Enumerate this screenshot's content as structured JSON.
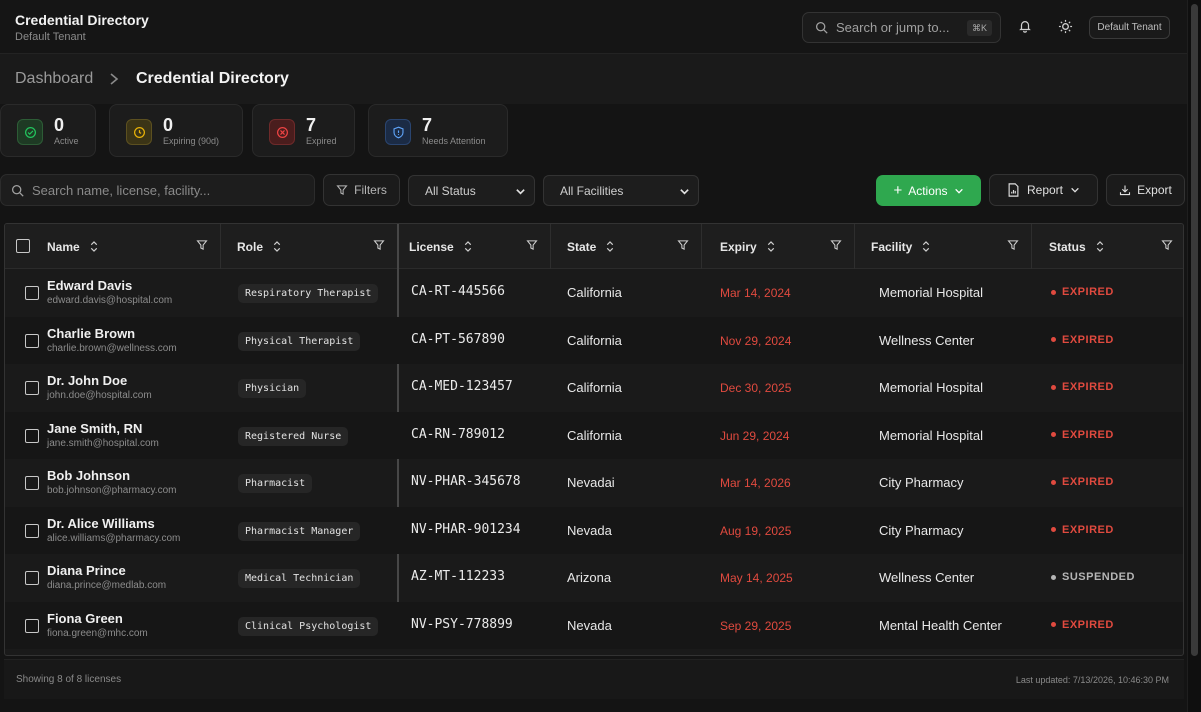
{
  "header": {
    "title": "Credential Directory",
    "subtitle": "Default Tenant",
    "search_placeholder": "Search or jump to...",
    "shortcut": "⌘K",
    "tenant_label": "Default Tenant"
  },
  "breadcrumb": {
    "root": "Dashboard",
    "separator": ">",
    "current": "Credential Directory"
  },
  "stats": [
    {
      "value": "0",
      "label": "Active",
      "color": "#22c55e"
    },
    {
      "value": "0",
      "label": "Expiring (90d)",
      "color": "#eab308"
    },
    {
      "value": "7",
      "label": "Expired",
      "color": "#ef4444"
    },
    {
      "value": "7",
      "label": "Needs Attention",
      "color": "#3b82f6"
    }
  ],
  "toolbar": {
    "search_placeholder": "Search name, license, facility...",
    "filters_label": "Filters",
    "status_select": "All Status",
    "facility_select": "All Facilities",
    "actions_label": "Actions",
    "report_label": "Report",
    "export_label": "Export",
    "accent": "#2fa84f"
  },
  "table": {
    "columns": [
      "Name",
      "Role",
      "License",
      "State",
      "Expiry",
      "Facility",
      "Status"
    ],
    "rows": [
      {
        "name": "Edward Davis",
        "email": "edward.davis@hospital.com",
        "role": "Respiratory Therapist",
        "license": "CA-RT-445566",
        "state": "California",
        "expiry": "Mar 14, 2024",
        "facility": "Memorial Hospital",
        "status": "EXPIRED"
      },
      {
        "name": "Charlie Brown",
        "email": "charlie.brown@wellness.com",
        "role": "Physical Therapist",
        "license": "CA-PT-567890",
        "state": "California",
        "expiry": "Nov 29, 2024",
        "facility": "Wellness Center",
        "status": "EXPIRED"
      },
      {
        "name": "Dr. John Doe",
        "email": "john.doe@hospital.com",
        "role": "Physician",
        "license": "CA-MED-123457",
        "state": "California",
        "expiry": "Dec 30, 2025",
        "facility": "Memorial Hospital",
        "status": "EXPIRED"
      },
      {
        "name": "Jane Smith, RN",
        "email": "jane.smith@hospital.com",
        "role": "Registered Nurse",
        "license": "CA-RN-789012",
        "state": "California",
        "expiry": "Jun 29, 2024",
        "facility": "Memorial Hospital",
        "status": "EXPIRED"
      },
      {
        "name": "Bob Johnson",
        "email": "bob.johnson@pharmacy.com",
        "role": "Pharmacist",
        "license": "NV-PHAR-345678",
        "state": "Nevadai",
        "expiry": "Mar 14, 2026",
        "facility": "City Pharmacy",
        "status": "EXPIRED"
      },
      {
        "name": "Dr. Alice Williams",
        "email": "alice.williams@pharmacy.com",
        "role": "Pharmacist Manager",
        "license": "NV-PHAR-901234",
        "state": "Nevada",
        "expiry": "Aug 19, 2025",
        "facility": "City Pharmacy",
        "status": "EXPIRED"
      },
      {
        "name": "Diana Prince",
        "email": "diana.prince@medlab.com",
        "role": "Medical Technician",
        "license": "AZ-MT-112233",
        "state": "Arizona",
        "expiry": "May 14, 2025",
        "facility": "Wellness Center",
        "status": "SUSPENDED"
      },
      {
        "name": "Fiona Green",
        "email": "fiona.green@mhc.com",
        "role": "Clinical Psychologist",
        "license": "NV-PSY-778899",
        "state": "Nevada",
        "expiry": "Sep 29, 2025",
        "facility": "Mental Health Center",
        "status": "EXPIRED"
      }
    ],
    "status_colors": {
      "EXPIRED": "#e04a3f",
      "SUSPENDED": "#b5b5b5"
    }
  },
  "footer": {
    "showing": "Showing 8 of 8 licenses",
    "updated": "Last updated: 7/13/2026, 10:46:30 PM"
  }
}
